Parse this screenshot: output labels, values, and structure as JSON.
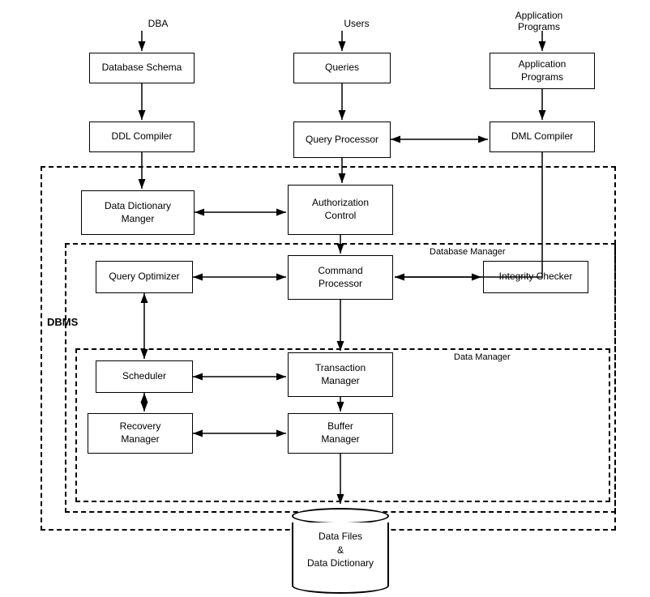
{
  "labels": {
    "dba": "DBA",
    "users": "Users",
    "appPrograms": "Application\nPrograms",
    "dbms": "DBMS",
    "dbManager": "Database Manager",
    "dataManager": "Data Manager"
  },
  "boxes": {
    "databaseSchema": "Database Schema",
    "queries": "Queries",
    "applicationPrograms": "Application\nPrograms",
    "ddlCompiler": "DDL Compiler",
    "queryProcessor": "Query Processor",
    "dmlCompiler": "DML Compiler",
    "dataDictManger": "Data Dictionary\nManger",
    "authorizationControl": "Authorization\nControl",
    "queryOptimizer": "Query Optimizer",
    "commandProcessor": "Command\nProcessor",
    "integrityChecker": "Integrity Checker",
    "scheduler": "Scheduler",
    "transactionManager": "Transaction\nManager",
    "recoveryManager": "Recovery\nManager",
    "bufferManager": "Buffer\nManager",
    "dataFiles": "Data Files\n&\nData Dictionary"
  }
}
